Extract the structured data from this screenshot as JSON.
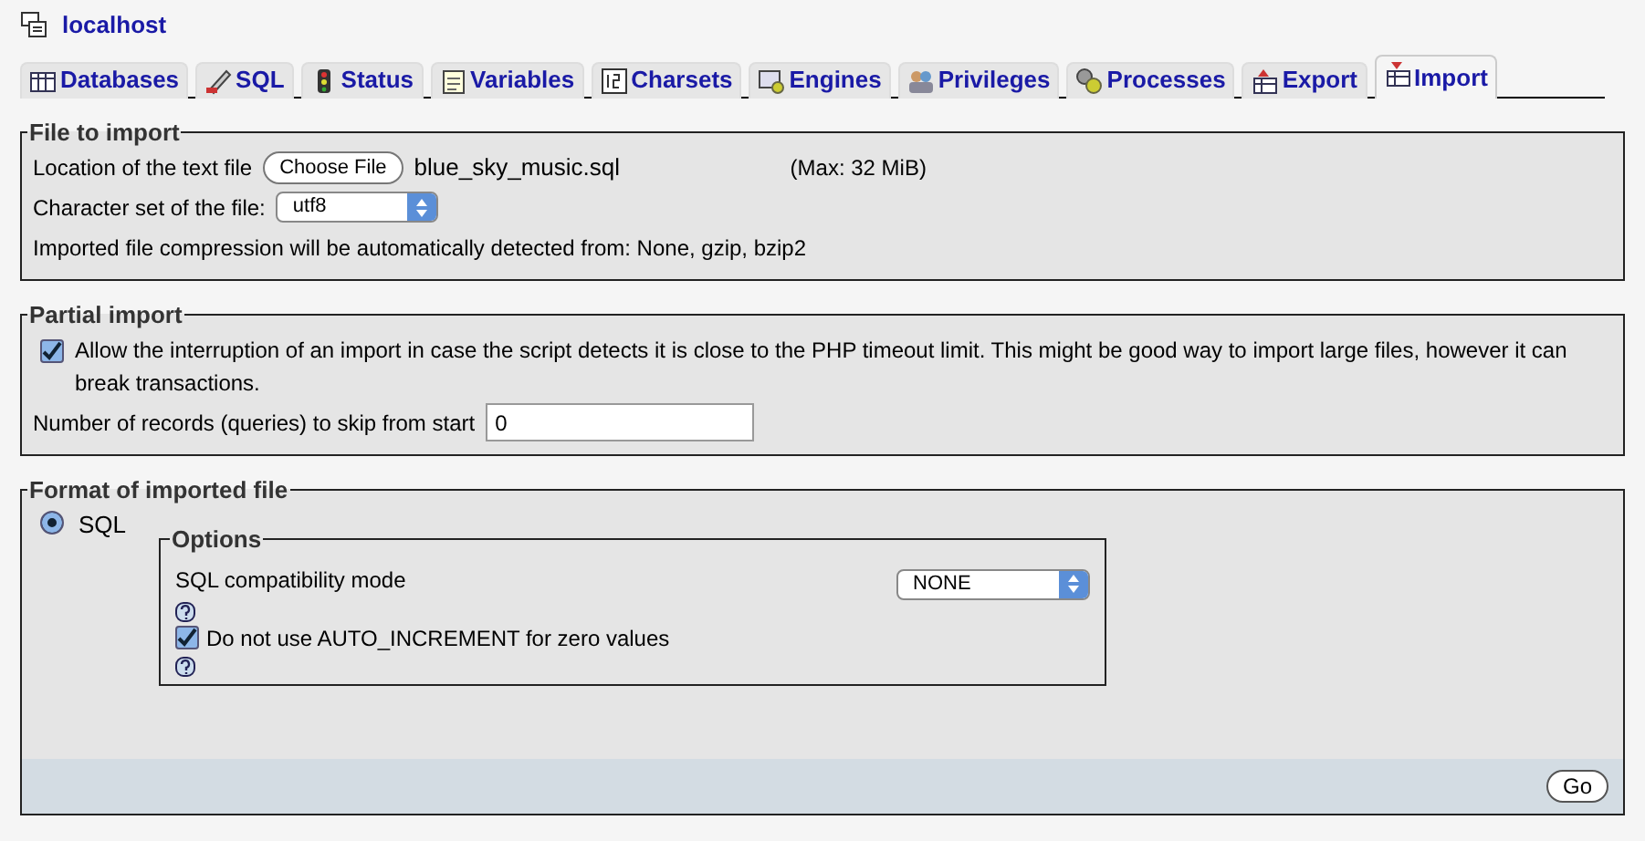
{
  "server": {
    "title": "localhost"
  },
  "tabs": [
    {
      "label": "Databases",
      "selected": false
    },
    {
      "label": "SQL",
      "selected": false
    },
    {
      "label": "Status",
      "selected": false
    },
    {
      "label": "Variables",
      "selected": false
    },
    {
      "label": "Charsets",
      "selected": false
    },
    {
      "label": "Engines",
      "selected": false
    },
    {
      "label": "Privileges",
      "selected": false
    },
    {
      "label": "Processes",
      "selected": false
    },
    {
      "label": "Export",
      "selected": false
    },
    {
      "label": "Import",
      "selected": true
    }
  ],
  "file_to_import": {
    "legend": "File to import",
    "location_label": "Location of the text file",
    "choose_button": "Choose File",
    "file_name": "blue_sky_music.sql",
    "max_size": "(Max: 32 MiB)",
    "charset_label": "Character set of the file:",
    "charset": "utf8",
    "compression_note": "Imported file compression will be automatically detected from: None, gzip, bzip2"
  },
  "partial_import": {
    "legend": "Partial import",
    "allow_interrupt": {
      "label": "Allow the interruption of an import in case the script detects it is close to the PHP timeout limit. This might be good way to import large files, however it can break transactions.",
      "checked": true
    },
    "skip_label": "Number of records (queries) to skip from start",
    "skip_value": "0"
  },
  "format": {
    "legend": "Format of imported file",
    "formats": [
      {
        "label": "SQL",
        "selected": true
      }
    ],
    "options": {
      "legend": "Options",
      "compat_label": "SQL compatibility mode",
      "compat_value": "NONE",
      "no_auto_increment": {
        "label": "Do not use AUTO_INCREMENT for zero values",
        "checked": true
      }
    }
  },
  "go_button": "Go"
}
